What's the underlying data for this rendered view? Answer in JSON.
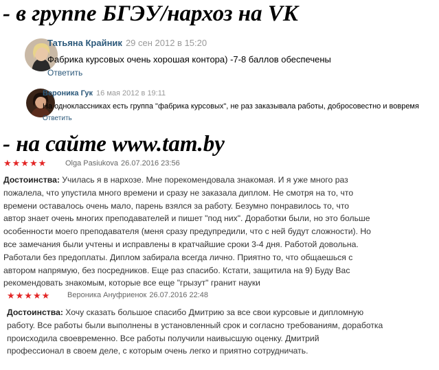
{
  "headings": {
    "vk": "- в группе БГЭУ/нархоз на VK",
    "site": "- на сайте  www.tam.by"
  },
  "vk_comments": [
    {
      "author": "Татьяна Крайник",
      "date": "29 сен 2012 в 15:20",
      "text": "Фабрика курсовых очень хорошая контора) -7-8 баллов обеспечены",
      "reply": "Ответить"
    },
    {
      "author": "Вероника Гук",
      "date": "16 мая 2012 в 19:11",
      "text": "На одноклассниках есть группа \"фабрика курсовых\", не раз заказывала работы, добросовестно и вовремя",
      "reply": "Ответить"
    }
  ],
  "reviews": [
    {
      "stars": "★★★★★",
      "rating": 5,
      "author": "Olga Pasiukova",
      "date": "26.07.2016 23:56",
      "label": "Достоинства:",
      "lines": [
        " Училась я в нархозе. Мне порекомендовала знакомая. И я уже много раз",
        "пожалела, что упустила много времени и сразу не заказала диплом. Не смотря на то, что",
        "времени оставалось очень мало, парень взялся за работу. Безумно понравилось то, что",
        "автор знает очень многих преподавателей и пишет \"под них\". Доработки были, но это больше",
        "особенности моего преподавателя (меня сразу предупредили, что с ней будут сложности). Но",
        "все замечания были учтены и исправлены в кратчайшие сроки 3-4 дня. Работой довольна.",
        "Работали без предоплаты. Диплом забирала всегда лично. Приятно то, что общаешься с",
        "автором напрямую, без посредников. Еще раз спасибо. Кстати, защитила на 9) Буду Вас",
        "рекомендовать знакомым, которые все еще \"грызут\" гранит науки"
      ]
    },
    {
      "stars": "★★★★★",
      "rating": 5,
      "author": "Вероника Ануфриенок",
      "date": "26.07.2016 22:48",
      "label": "Достоинства:",
      "lines": [
        " Хочу сказать большое спасибо Дмитрию за все свои курсовые и дипломную",
        "работу. Все работы были выполнены в установленный срок и согласно требованиям, доработка",
        "происходила своевременно. Все работы получили наивысшую оценку. Дмитрий",
        "профессионал в своем деле, с которым очень легко и приятно сотрудничать."
      ]
    }
  ],
  "colors": {
    "vk_link": "#2b587a",
    "stars": "#e32626"
  },
  "icons": {
    "avatar1": "user-photo-icon",
    "avatar2": "user-photo-icon"
  }
}
